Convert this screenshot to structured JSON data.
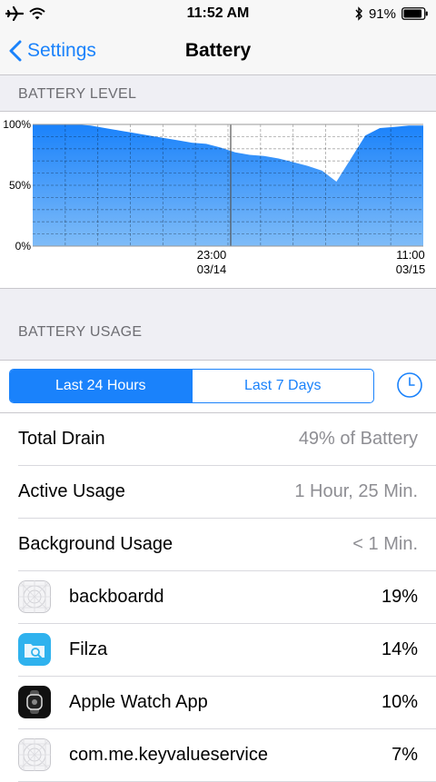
{
  "status_bar": {
    "time": "11:52 AM",
    "battery_percent": "91%",
    "battery_fill_fraction": 0.91
  },
  "nav": {
    "back_label": "Settings",
    "title": "Battery"
  },
  "battery_level": {
    "section_header": "BATTERY LEVEL",
    "chart_data": {
      "type": "area",
      "y_tick_labels": [
        "100%",
        "50%",
        "0%"
      ],
      "ylim": [
        0,
        100
      ],
      "x_tick_labels": [
        {
          "time": "23:00",
          "date": "03/14"
        },
        {
          "time": "11:00",
          "date": "03/15"
        }
      ],
      "values": [
        100,
        100,
        100,
        100,
        99,
        97,
        95,
        93,
        91,
        89,
        87,
        85,
        84,
        81,
        77,
        75,
        74,
        72,
        69,
        66,
        62,
        53,
        72,
        91,
        97,
        98,
        99,
        99
      ],
      "grid": true,
      "fill_color": "#1a82fb"
    }
  },
  "battery_usage": {
    "section_header": "BATTERY USAGE",
    "tabs": [
      {
        "label": "Last 24 Hours",
        "selected": true
      },
      {
        "label": "Last 7 Days",
        "selected": false
      }
    ],
    "rows": [
      {
        "label": "Total Drain",
        "value": "49% of Battery"
      },
      {
        "label": "Active Usage",
        "value": "1 Hour, 25 Min."
      },
      {
        "label": "Background Usage",
        "value": "< 1 Min."
      }
    ],
    "apps": [
      {
        "name": "backboardd",
        "value": "19%",
        "icon": "placeholder-app-icon"
      },
      {
        "name": "Filza",
        "value": "14%",
        "icon": "filza-folder-icon"
      },
      {
        "name": "Apple Watch App",
        "value": "10%",
        "icon": "apple-watch-icon"
      },
      {
        "name": "com.me.keyvalueservice",
        "value": "7%",
        "icon": "placeholder-app-icon"
      }
    ]
  },
  "colors": {
    "accent": "#1a82fb",
    "background": "#efeff4",
    "secondary_text": "#8e8e93",
    "section_header": "#6d6d72"
  }
}
